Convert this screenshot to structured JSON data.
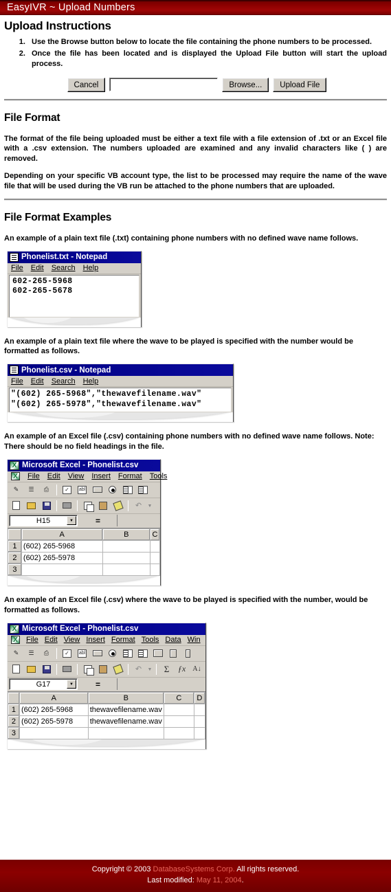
{
  "header": {
    "title": "EasyIVR ~ Upload Numbers",
    "bg_color": "#8b0000",
    "text_color": "#ffffff"
  },
  "instructions_section": {
    "heading": "Upload Instructions",
    "items": [
      "Use the Browse button below to locate the file containing the phone numbers to be processed.",
      "Once the file has been located and is displayed the Upload File button will start the upload process."
    ]
  },
  "upload_form": {
    "cancel_label": "Cancel",
    "file_value": "",
    "file_placeholder": "",
    "browse_label": "Browse...",
    "upload_label": "Upload File"
  },
  "file_format_section": {
    "heading": "File Format",
    "paragraph1": "The format of the file being uploaded must be either a text file with a file extension of .txt or an Excel file with a .csv extension. The numbers uploaded are examined and any invalid characters like ( ) are removed.",
    "paragraph2": "Depending on your specific VB account type, the list to be processed may require the name of the wave file that will be used during the VB run be attached to the phone numbers that are uploaded."
  },
  "examples_section": {
    "heading": "File Format Examples",
    "caption1": "An example of a plain text file (.txt) containing phone numbers with no defined wave name follows.",
    "caption2": "An example of a plain text file where the wave to be played is specified with the number would be formatted as follows.",
    "caption3": "An example of an Excel file (.csv) containing phone numbers with no defined wave name follows. Note: There should be no field headings in the file.",
    "caption4": "An example of an Excel file (.csv) where the wave to be played is specified with the number, would be formatted as follows."
  },
  "notepad1": {
    "title": "Phonelist.txt - Notepad",
    "menu": [
      "File",
      "Edit",
      "Search",
      "Help"
    ],
    "lines": [
      "602-265-5968",
      "602-265-5678"
    ]
  },
  "notepad2": {
    "title": "Phonelist.csv - Notepad",
    "menu": [
      "File",
      "Edit",
      "Search",
      "Help"
    ],
    "lines": [
      "\"(602) 265-5968\",\"thewavefilename.wav\"",
      "\"(602) 265-5978\",\"thewavefilename.wav\""
    ]
  },
  "excel1": {
    "title": "Microsoft Excel - Phonelist.csv",
    "menu": [
      "File",
      "Edit",
      "View",
      "Insert",
      "Format",
      "Tools"
    ],
    "namebox": "H15",
    "equals": "=",
    "columns": [
      "A",
      "B",
      "C"
    ],
    "rows": [
      {
        "num": "1",
        "cells": [
          "(602) 265-5968",
          "",
          ""
        ]
      },
      {
        "num": "2",
        "cells": [
          "(602) 265-5978",
          "",
          ""
        ]
      },
      {
        "num": "3",
        "cells": [
          "",
          "",
          ""
        ]
      }
    ]
  },
  "excel2": {
    "title": "Microsoft Excel - Phonelist.csv",
    "menu": [
      "File",
      "Edit",
      "View",
      "Insert",
      "Format",
      "Tools",
      "Data",
      "Win"
    ],
    "namebox": "G17",
    "equals": "=",
    "columns": [
      "A",
      "B",
      "C",
      "D"
    ],
    "rows": [
      {
        "num": "1",
        "cells": [
          "(602) 265-5968",
          "thewavefilename.wav",
          "",
          ""
        ]
      },
      {
        "num": "2",
        "cells": [
          "(602) 265-5978",
          "thewavefilename.wav",
          "",
          ""
        ]
      },
      {
        "num": "3",
        "cells": [
          "",
          "",
          "",
          ""
        ]
      }
    ]
  },
  "footer": {
    "copyright_prefix": "Copyright © 2003 ",
    "company_link": "DatabaseSystems Corp.",
    "copyright_suffix": " All rights reserved.",
    "last_modified_label": "Last modified: ",
    "last_modified_date": "May 11, 2004",
    "last_modified_period": ".",
    "link_color": "#e8655a",
    "bg_color": "#8b0000"
  }
}
